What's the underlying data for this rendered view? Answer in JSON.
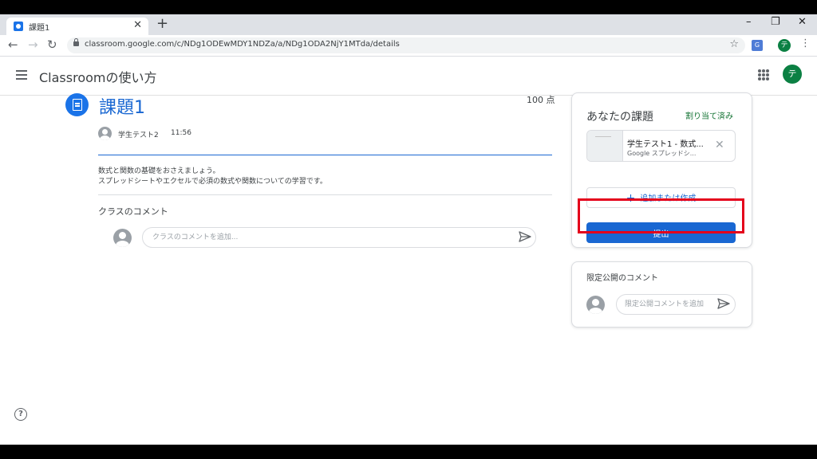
{
  "browser": {
    "tab_title": "課題1",
    "url": "classroom.google.com/c/NDg1ODEwMDY1NDZa/a/NDg1ODA2NjY1MTda/details",
    "profile_initial": "テ"
  },
  "app": {
    "title": "Classroomの使い方",
    "user_initial": "テ"
  },
  "assignment": {
    "title": "課題1",
    "points": "100 点",
    "poster": "学生テスト2",
    "time": "11:56",
    "description_line1": "数式と関数の基礎をおさえましょう。",
    "description_line2": "スプレッドシートやエクセルで必須の数式や関数についての学習です。"
  },
  "class_comments": {
    "heading": "クラスのコメント",
    "placeholder": "クラスのコメントを追加..."
  },
  "your_work": {
    "title": "あなたの課題",
    "status": "割り当て済み",
    "attachment_name": "学生テスト1 - 数式...",
    "attachment_type": "Google スプレッドシ...",
    "add_label": "追加または作成",
    "submit_label": "提出"
  },
  "private_comments": {
    "heading": "限定公開のコメント",
    "placeholder": "限定公開コメントを追加"
  },
  "colors": {
    "accent": "#1967d2",
    "status_green": "#137333",
    "highlight_red": "#e4001b"
  }
}
